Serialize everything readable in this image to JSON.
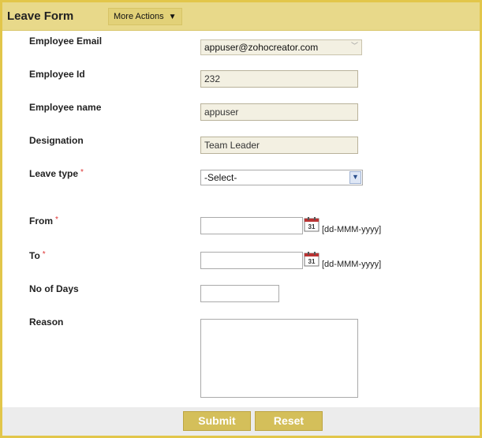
{
  "header": {
    "title": "Leave Form",
    "more_actions_label": "More Actions",
    "more_actions_icon": "caret-down-icon"
  },
  "fields": {
    "employee_email": {
      "label": "Employee Email",
      "value": "appuser@zohocreator.com"
    },
    "employee_id": {
      "label": "Employee Id",
      "value": "232"
    },
    "employee_name": {
      "label": "Employee name",
      "value": "appuser"
    },
    "designation": {
      "label": "Designation",
      "value": "Team Leader"
    },
    "leave_type": {
      "label": "Leave type",
      "required_mark": "*",
      "value": "-Select-"
    },
    "from": {
      "label": "From",
      "required_mark": "*",
      "value": "",
      "format_hint": "[dd-MMM-yyyy]",
      "calendar_day": "31"
    },
    "to": {
      "label": "To",
      "required_mark": "*",
      "value": "",
      "format_hint": "[dd-MMM-yyyy]",
      "calendar_day": "31"
    },
    "no_of_days": {
      "label": "No of Days",
      "value": ""
    },
    "reason": {
      "label": "Reason",
      "value": ""
    }
  },
  "footer": {
    "submit_label": "Submit",
    "reset_label": "Reset"
  },
  "watermark": "",
  "colors": {
    "frame_border": "#e2c64a",
    "header_bg": "#e8d98a",
    "button_bg": "#d4bf5a",
    "required": "#dd3333"
  }
}
